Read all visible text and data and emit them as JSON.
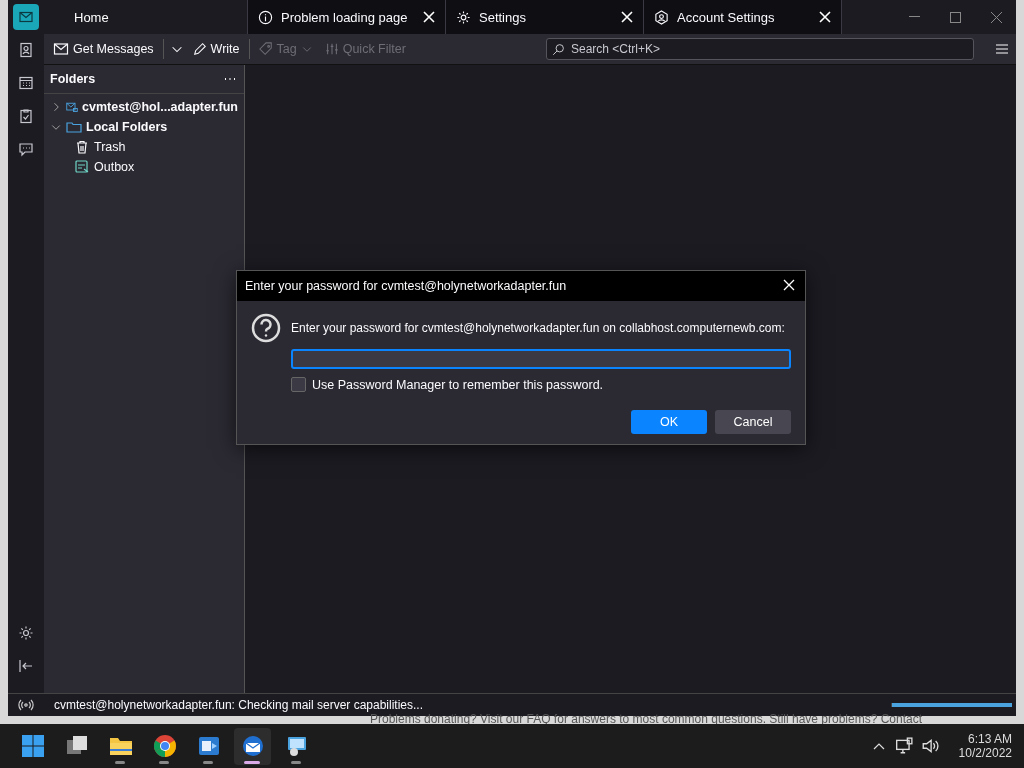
{
  "tabs": [
    {
      "kind": "home",
      "label": "Home",
      "selected": true
    },
    {
      "kind": "info",
      "label": "Problem loading page",
      "selected": false
    },
    {
      "kind": "gear",
      "label": "Settings",
      "selected": false
    },
    {
      "kind": "account",
      "label": "Account Settings",
      "selected": false
    }
  ],
  "toolbar": {
    "get_messages": "Get Messages",
    "write": "Write",
    "tag": "Tag",
    "quick_filter": "Quick Filter",
    "search_placeholder": "Search <Ctrl+K>"
  },
  "folder_pane": {
    "title": "Folders",
    "folders": [
      {
        "kind": "account",
        "label": "cvmtest@hol...adapter.fun",
        "expanded": false
      },
      {
        "kind": "local",
        "label": "Local Folders",
        "expanded": true,
        "children": [
          {
            "kind": "trash",
            "label": "Trash"
          },
          {
            "kind": "outbox",
            "label": "Outbox"
          }
        ]
      }
    ]
  },
  "status_bar": {
    "text": "cvmtest@holynetworkadapter.fun: Checking mail server capabilities...",
    "level": 1
  },
  "background_text": "Problems donating? Visit our FAQ for answers to most common questions. Still have problems? Contact",
  "dialog": {
    "title": "Enter your password for cvmtest@holynetworkadapter.fun",
    "message": "Enter your password for cvmtest@holynetworkadapter.fun on collabhost.computernewb.com:",
    "checkbox": {
      "label": "Use Password Manager to remember this password.",
      "checked": false
    },
    "buttons": [
      {
        "label": "OK",
        "kind": "primary"
      },
      {
        "label": "Cancel",
        "kind": "secondary"
      }
    ]
  },
  "taskbar": {
    "apps": [
      {
        "kind": "start",
        "active": false
      },
      {
        "kind": "taskview",
        "active": false
      },
      {
        "kind": "explorer",
        "active": false
      },
      {
        "kind": "chrome",
        "active": false
      },
      {
        "kind": "teams",
        "active": false
      },
      {
        "kind": "mail",
        "active": true
      },
      {
        "kind": "rdp",
        "active": false
      }
    ],
    "time": "6:13 AM",
    "date": "10/2/2022"
  }
}
